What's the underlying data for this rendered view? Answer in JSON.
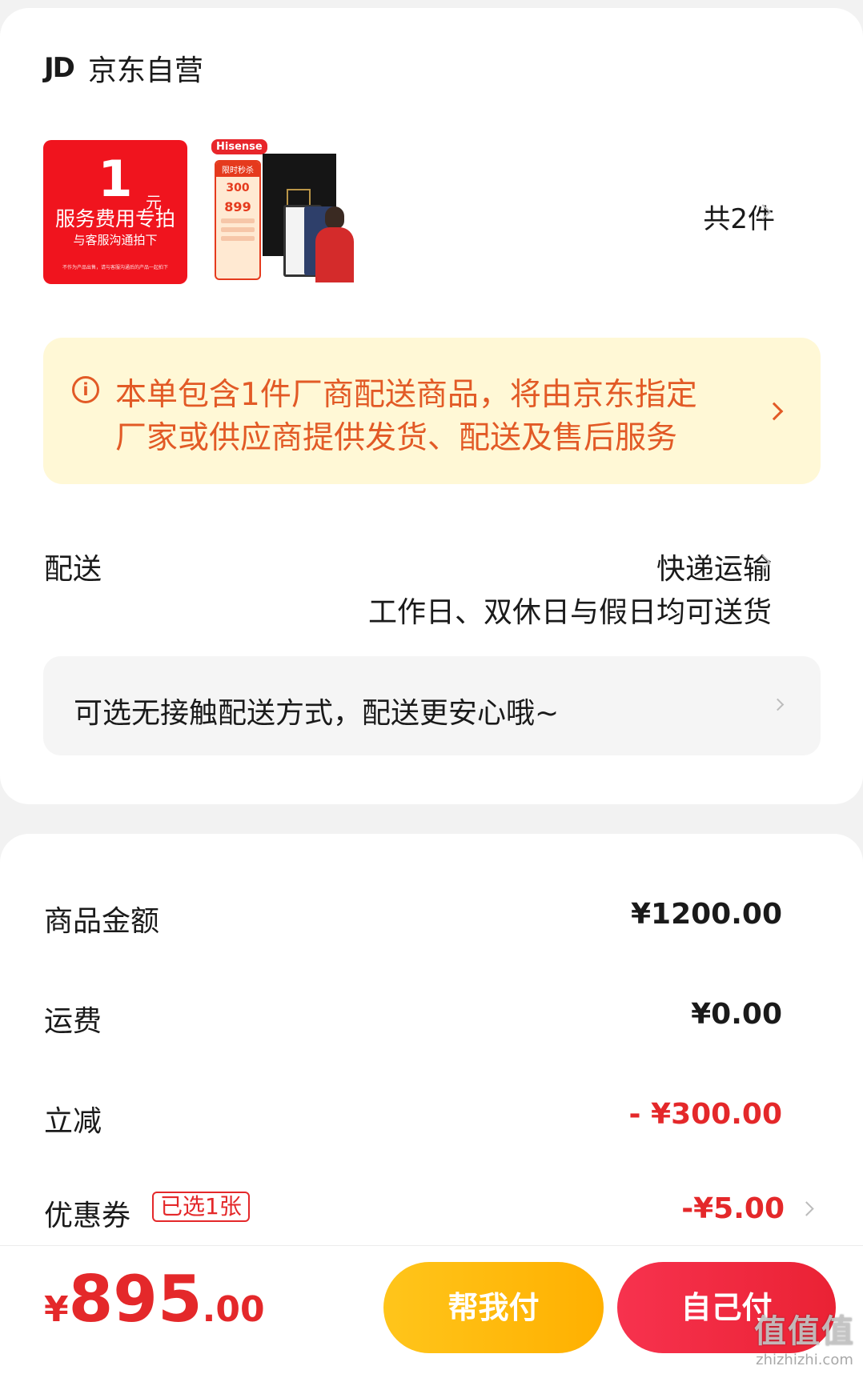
{
  "shop": {
    "logo": "JD",
    "name": "京东自营"
  },
  "items": {
    "service_thumb": {
      "big": "1",
      "yuan": "元",
      "line1": "服务费用专拍",
      "line2": "与客服沟通拍下",
      "line3": "不作为产品出售，请与客服沟通后的产品一起拍下"
    },
    "product_thumb": {
      "brand": "Hisense",
      "promo_head": "限时秒杀",
      "promo_discount": "300",
      "promo_price": "899"
    },
    "count_label": "共2件"
  },
  "notice": {
    "line1": "本单包含1件厂商配送商品，将由京东指定",
    "line2": "厂家或供应商提供发货、配送及售后服务",
    "icon_text": "i"
  },
  "shipping": {
    "label": "配送",
    "method": "快递运输",
    "time": "工作日、双休日与假日均可送货",
    "contactless": "可选无接触配送方式，配送更安心哦~"
  },
  "summary": {
    "goods_label": "商品金额",
    "goods_value": "¥1200.00",
    "freight_label": "运费",
    "freight_value": "¥0.00",
    "discount_label": "立减",
    "discount_value": "- ¥300.00",
    "coupon_label": "优惠券",
    "coupon_tag": "已选1张",
    "coupon_value": "-¥5.00"
  },
  "bottom": {
    "currency": "¥",
    "total_int": "895",
    "total_dec": ".00",
    "help_pay": "帮我付",
    "self_pay": "自己付"
  },
  "watermark": {
    "big": "值值值",
    "small": "zhizhizhi.com"
  },
  "colors": {
    "accent_red": "#e4282a",
    "notice_bg": "#fff8d6",
    "notice_text": "#e25a26",
    "help_btn": "#ffb000",
    "self_btn": "#ea2234"
  }
}
